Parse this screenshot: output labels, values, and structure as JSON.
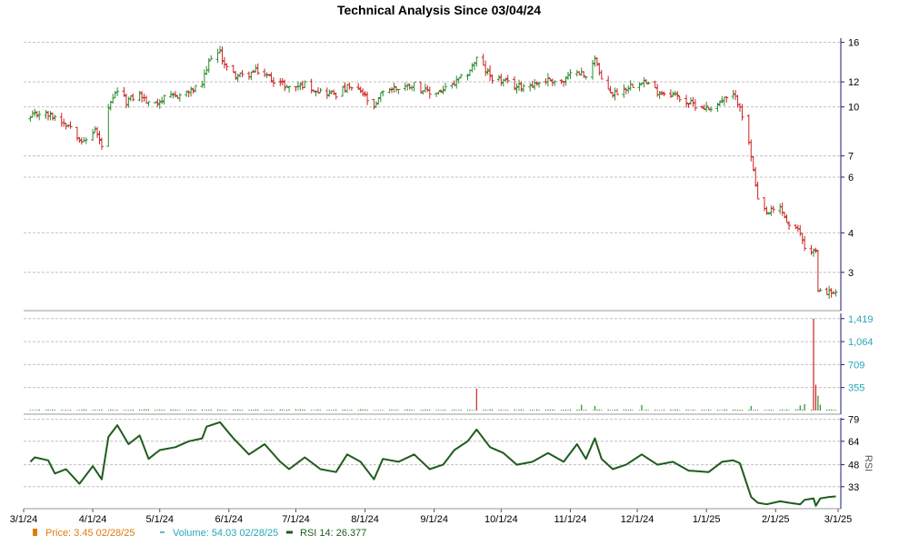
{
  "chart_data": {
    "type": "candlestick-ohlc",
    "title": "Technical Analysis Since 03/04/24",
    "x_ticks": [
      "3/1/24",
      "4/1/24",
      "5/1/24",
      "6/1/24",
      "7/1/24",
      "8/1/24",
      "9/1/24",
      "10/1/24",
      "11/1/24",
      "12/1/24",
      "1/1/25",
      "2/1/25",
      "3/1/25"
    ],
    "price_axis": {
      "scale": "log",
      "ticks": [
        3,
        4,
        6,
        7,
        10,
        12,
        16
      ],
      "tick_labels": [
        "3",
        "4",
        "6",
        "7",
        "10",
        "12",
        "16"
      ],
      "range": [
        2.3,
        16.5
      ]
    },
    "volume_axis": {
      "ticks": [
        355,
        709,
        1064,
        1419
      ],
      "tick_labels": [
        "355",
        "709",
        "1,064",
        "1,419"
      ],
      "range": [
        0,
        1500
      ]
    },
    "rsi_axis": {
      "ticks": [
        33,
        48,
        64,
        79
      ],
      "tick_labels": [
        "33",
        "48",
        "64",
        "79"
      ],
      "range": [
        18,
        80
      ],
      "label": "RSI"
    },
    "grid": true,
    "price_series": {
      "up_color": "#2e8b2e",
      "down_color": "#cc2222",
      "anchors": [
        [
          "2024-03-04",
          9.2
        ],
        [
          "2024-03-08",
          9.6
        ],
        [
          "2024-03-15",
          9.3
        ],
        [
          "2024-03-22",
          8.7
        ],
        [
          "2024-03-28",
          7.7
        ],
        [
          "2024-04-02",
          8.5
        ],
        [
          "2024-04-05",
          7.5
        ],
        [
          "2024-04-08",
          9.8
        ],
        [
          "2024-04-12",
          11.3
        ],
        [
          "2024-04-16",
          10.4
        ],
        [
          "2024-04-22",
          11.0
        ],
        [
          "2024-04-26",
          10.2
        ],
        [
          "2024-05-01",
          10.5
        ],
        [
          "2024-05-08",
          10.8
        ],
        [
          "2024-05-15",
          11.2
        ],
        [
          "2024-05-20",
          11.8
        ],
        [
          "2024-05-24",
          14.5
        ],
        [
          "2024-05-28",
          14.8
        ],
        [
          "2024-06-01",
          12.8
        ],
        [
          "2024-06-07",
          12.5
        ],
        [
          "2024-06-14",
          13.0
        ],
        [
          "2024-06-21",
          12.2
        ],
        [
          "2024-06-28",
          11.5
        ],
        [
          "2024-07-05",
          11.8
        ],
        [
          "2024-07-12",
          11.2
        ],
        [
          "2024-07-19",
          11.0
        ],
        [
          "2024-07-24",
          11.5
        ],
        [
          "2024-07-30",
          11.2
        ],
        [
          "2024-08-02",
          10.5
        ],
        [
          "2024-08-05",
          9.8
        ],
        [
          "2024-08-09",
          11.3
        ],
        [
          "2024-08-16",
          11.5
        ],
        [
          "2024-08-23",
          11.8
        ],
        [
          "2024-08-30",
          11.0
        ],
        [
          "2024-09-05",
          11.3
        ],
        [
          "2024-09-10",
          11.8
        ],
        [
          "2024-09-16",
          12.8
        ],
        [
          "2024-09-20",
          14.2
        ],
        [
          "2024-09-26",
          12.5
        ],
        [
          "2024-10-02",
          12.0
        ],
        [
          "2024-10-08",
          11.6
        ],
        [
          "2024-10-15",
          11.8
        ],
        [
          "2024-10-22",
          12.2
        ],
        [
          "2024-10-29",
          12.0
        ],
        [
          "2024-11-04",
          13.2
        ],
        [
          "2024-11-08",
          12.3
        ],
        [
          "2024-11-12",
          14.5
        ],
        [
          "2024-11-15",
          12.0
        ],
        [
          "2024-11-20",
          11.0
        ],
        [
          "2024-11-26",
          11.5
        ],
        [
          "2024-12-03",
          12.2
        ],
        [
          "2024-12-10",
          11.2
        ],
        [
          "2024-12-17",
          11.0
        ],
        [
          "2024-12-24",
          10.3
        ],
        [
          "2025-01-02",
          9.9
        ],
        [
          "2025-01-08",
          10.5
        ],
        [
          "2025-01-13",
          10.8
        ],
        [
          "2025-01-16",
          10.2
        ],
        [
          "2025-01-21",
          7.0
        ],
        [
          "2025-01-24",
          5.0
        ],
        [
          "2025-01-28",
          4.6
        ],
        [
          "2025-02-03",
          4.8
        ],
        [
          "2025-02-07",
          4.2
        ],
        [
          "2025-02-12",
          4.0
        ],
        [
          "2025-02-14",
          3.6
        ],
        [
          "2025-02-18",
          3.5
        ],
        [
          "2025-02-19",
          2.5
        ],
        [
          "2025-02-21",
          2.65
        ],
        [
          "2025-02-25",
          2.6
        ],
        [
          "2025-02-28",
          2.55
        ]
      ],
      "gaps": [
        "2025-02-18"
      ]
    },
    "volume_series": {
      "color": "#2e8b2e",
      "spike_color": "#cc2222",
      "baseline": 14,
      "spikes": [
        [
          "2024-09-20",
          340
        ],
        [
          "2024-11-06",
          90
        ],
        [
          "2024-11-12",
          70
        ],
        [
          "2024-12-03",
          85
        ],
        [
          "2025-01-21",
          70
        ],
        [
          "2025-02-12",
          80
        ],
        [
          "2025-02-14",
          100
        ],
        [
          "2025-02-18",
          1419
        ],
        [
          "2025-02-19",
          400
        ],
        [
          "2025-02-20",
          230
        ],
        [
          "2025-02-21",
          90
        ]
      ]
    },
    "rsi_series": {
      "color": "#1e5c1e",
      "values": [
        [
          "2024-03-04",
          50
        ],
        [
          "2024-03-06",
          53
        ],
        [
          "2024-03-12",
          51
        ],
        [
          "2024-03-15",
          42
        ],
        [
          "2024-03-20",
          45
        ],
        [
          "2024-03-26",
          35
        ],
        [
          "2024-04-01",
          47
        ],
        [
          "2024-04-05",
          38
        ],
        [
          "2024-04-08",
          67
        ],
        [
          "2024-04-12",
          75
        ],
        [
          "2024-04-17",
          62
        ],
        [
          "2024-04-22",
          68
        ],
        [
          "2024-04-26",
          52
        ],
        [
          "2024-05-01",
          58
        ],
        [
          "2024-05-08",
          60
        ],
        [
          "2024-05-14",
          64
        ],
        [
          "2024-05-20",
          66
        ],
        [
          "2024-05-22",
          74
        ],
        [
          "2024-05-28",
          77
        ],
        [
          "2024-06-03",
          66
        ],
        [
          "2024-06-10",
          55
        ],
        [
          "2024-06-17",
          62
        ],
        [
          "2024-06-24",
          50
        ],
        [
          "2024-06-28",
          45
        ],
        [
          "2024-07-05",
          53
        ],
        [
          "2024-07-12",
          45
        ],
        [
          "2024-07-19",
          43
        ],
        [
          "2024-07-24",
          55
        ],
        [
          "2024-07-30",
          50
        ],
        [
          "2024-08-05",
          38
        ],
        [
          "2024-08-09",
          52
        ],
        [
          "2024-08-16",
          50
        ],
        [
          "2024-08-23",
          55
        ],
        [
          "2024-08-30",
          45
        ],
        [
          "2024-09-05",
          48
        ],
        [
          "2024-09-10",
          58
        ],
        [
          "2024-09-16",
          64
        ],
        [
          "2024-09-20",
          72
        ],
        [
          "2024-09-26",
          60
        ],
        [
          "2024-10-02",
          56
        ],
        [
          "2024-10-08",
          48
        ],
        [
          "2024-10-15",
          50
        ],
        [
          "2024-10-22",
          56
        ],
        [
          "2024-10-29",
          50
        ],
        [
          "2024-11-04",
          62
        ],
        [
          "2024-11-08",
          52
        ],
        [
          "2024-11-12",
          66
        ],
        [
          "2024-11-15",
          52
        ],
        [
          "2024-11-20",
          45
        ],
        [
          "2024-11-26",
          48
        ],
        [
          "2024-12-03",
          55
        ],
        [
          "2024-12-10",
          48
        ],
        [
          "2024-12-17",
          50
        ],
        [
          "2024-12-24",
          44
        ],
        [
          "2025-01-02",
          43
        ],
        [
          "2025-01-08",
          50
        ],
        [
          "2025-01-13",
          51
        ],
        [
          "2025-01-16",
          49
        ],
        [
          "2025-01-21",
          26
        ],
        [
          "2025-01-24",
          22
        ],
        [
          "2025-01-28",
          21
        ],
        [
          "2025-02-03",
          23
        ],
        [
          "2025-02-07",
          22
        ],
        [
          "2025-02-12",
          21
        ],
        [
          "2025-02-14",
          24
        ],
        [
          "2025-02-18",
          25
        ],
        [
          "2025-02-19",
          20
        ],
        [
          "2025-02-21",
          25
        ],
        [
          "2025-02-25",
          26
        ],
        [
          "2025-02-28",
          26.4
        ]
      ]
    },
    "legend": [
      {
        "label": "Price: 3.45  02/28/25",
        "color": "#e07b10",
        "marker": "square"
      },
      {
        "label": "Volume: 54.03  02/28/25",
        "color": "#2aa7b8",
        "marker": "dash"
      },
      {
        "label": "RSI 14: 26.377",
        "color": "#1e5c1e",
        "marker": "dash-bold"
      }
    ]
  },
  "colors": {
    "grid": "#c0c0c0",
    "axis": "#1a1a6e",
    "volume_axis_text": "#2aa7b8"
  }
}
